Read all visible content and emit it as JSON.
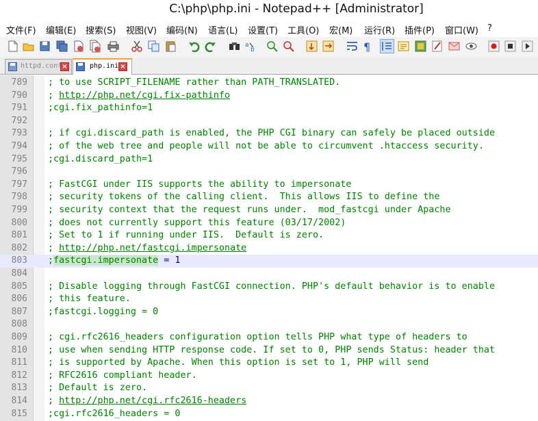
{
  "window": {
    "title": "C:\\php\\php.ini - Notepad++ [Administrator]"
  },
  "menu": [
    "文件(F)",
    "编辑(E)",
    "搜索(S)",
    "视图(V)",
    "编码(N)",
    "语言(L)",
    "设置(T)",
    "工具(O)",
    "宏(M)",
    "运行(R)",
    "插件(P)",
    "窗口(W)",
    "?"
  ],
  "toolbar_icons": [
    "new-file-icon",
    "open-file-icon",
    "save-icon",
    "save-all-icon",
    "close-icon",
    "close-all-icon",
    "print-icon",
    "cut-icon",
    "copy-icon",
    "paste-icon",
    "undo-icon",
    "redo-icon",
    "find-icon",
    "replace-icon",
    "zoom-in-icon",
    "zoom-out-icon",
    "sync-v-icon",
    "sync-h-icon",
    "word-wrap-icon",
    "show-all-chars-icon",
    "indent-guide-icon",
    "doc-map-icon",
    "function-list-icon",
    "folder-workspace-icon",
    "monitor-icon",
    "record-macro-icon",
    "stop-macro-icon",
    "play-macro-icon"
  ],
  "tabs": [
    {
      "label": "httpd.conf",
      "active": false
    },
    {
      "label": "php.ini",
      "active": true
    }
  ],
  "editor": {
    "lines": [
      {
        "num": "789",
        "text": "; to use SCRIPT_FILENAME rather than PATH_TRANSLATED."
      },
      {
        "num": "790",
        "prefix": "; ",
        "link": "http://php.net/cgi.fix-pathinfo"
      },
      {
        "num": "791",
        "text": ";cgi.fix_pathinfo=1"
      },
      {
        "num": "792",
        "text": ""
      },
      {
        "num": "793",
        "text": "; if cgi.discard_path is enabled, the PHP CGI binary can safely be placed outside"
      },
      {
        "num": "794",
        "text": "; of the web tree and people will not be able to circumvent .htaccess security."
      },
      {
        "num": "795",
        "text": ";cgi.discard_path=1"
      },
      {
        "num": "796",
        "text": ""
      },
      {
        "num": "797",
        "text": "; FastCGI under IIS supports the ability to impersonate"
      },
      {
        "num": "798",
        "text": "; security tokens of the calling client.  This allows IIS to define the"
      },
      {
        "num": "799",
        "text": "; security context that the request runs under.  mod_fastcgi under Apache"
      },
      {
        "num": "800",
        "text": "; does not currently support this feature (03/17/2002)"
      },
      {
        "num": "801",
        "text": "; Set to 1 if running under IIS.  Default is zero."
      },
      {
        "num": "802",
        "prefix": "; ",
        "link": "http://php.net/fastcgi.impersonate"
      },
      {
        "num": "803",
        "prefix": ";",
        "highlight": "fastcgi.impersonate",
        "suffix": " = 1",
        "current": true
      },
      {
        "num": "804",
        "text": ""
      },
      {
        "num": "805",
        "text": "; Disable logging through FastCGI connection. PHP's default behavior is to enable"
      },
      {
        "num": "806",
        "text": "; this feature."
      },
      {
        "num": "807",
        "text": ";fastcgi.logging = 0"
      },
      {
        "num": "808",
        "text": ""
      },
      {
        "num": "809",
        "text": "; cgi.rfc2616_headers configuration option tells PHP what type of headers to"
      },
      {
        "num": "810",
        "text": "; use when sending HTTP response code. If set to 0, PHP sends Status: header that"
      },
      {
        "num": "811",
        "text": "; is supported by Apache. When this option is set to 1, PHP will send"
      },
      {
        "num": "812",
        "text": "; RFC2616 compliant header."
      },
      {
        "num": "813",
        "text": "; Default is zero."
      },
      {
        "num": "814",
        "prefix": "; ",
        "link": "http://php.net/cgi.rfc2616-headers"
      },
      {
        "num": "815",
        "text": ";cgi.rfc2616_headers = 0"
      }
    ]
  }
}
